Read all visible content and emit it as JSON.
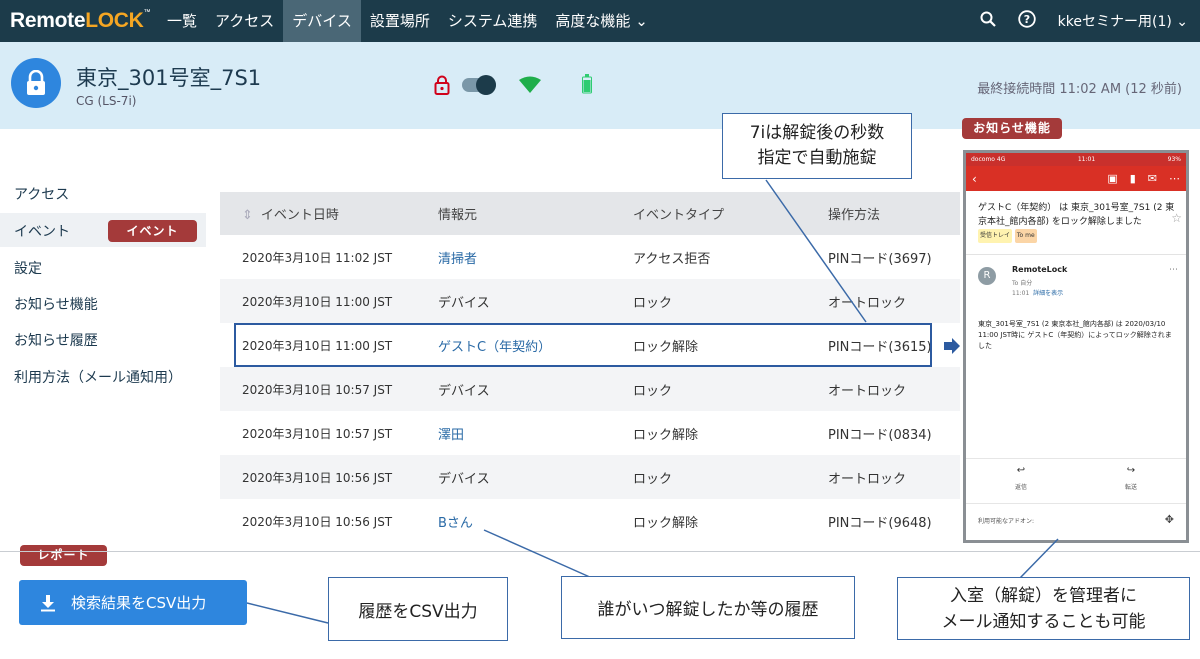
{
  "brand": {
    "logo_pre": "Remote",
    "logo_accent": "LOCK",
    "logo_tm": "™",
    "accent_color": "#f5a623"
  },
  "nav": {
    "items": [
      "一覧",
      "アクセス",
      "デバイス",
      "設置場所",
      "システム連携",
      "高度な機能 ⌄"
    ],
    "active": "デバイス",
    "account": "kkeセミナー用(1) ⌄"
  },
  "device": {
    "name": "東京_301号室_7S1",
    "model": "CG (LS-7i)",
    "last_connection": "最終接続時間 11:02 AM (12 秒前)"
  },
  "sidebar": {
    "items": [
      "アクセス",
      "イベント",
      "設定",
      "お知らせ機能",
      "お知らせ履歴",
      "利用方法（メール通知用）"
    ],
    "active": "イベント"
  },
  "tags": {
    "event": "イベント",
    "notice": "お知らせ機能",
    "report": "レポート"
  },
  "table": {
    "headers": [
      "イベント日時",
      "情報元",
      "イベントタイプ",
      "操作方法"
    ],
    "rows": [
      [
        "2020年3月10日 11:02 JST",
        "清掃者",
        "アクセス拒否",
        "PINコード(3697)"
      ],
      [
        "2020年3月10日 11:00 JST",
        "デバイス",
        "ロック",
        "オートロック"
      ],
      [
        "2020年3月10日 11:00 JST",
        "ゲストC（年契約）",
        "ロック解除",
        "PINコード(3615)"
      ],
      [
        "2020年3月10日 10:57 JST",
        "デバイス",
        "ロック",
        "オートロック"
      ],
      [
        "2020年3月10日 10:57 JST",
        "澤田",
        "ロック解除",
        "PINコード(0834)"
      ],
      [
        "2020年3月10日 10:56 JST",
        "デバイス",
        "ロック",
        "オートロック"
      ],
      [
        "2020年3月10日 10:56 JST",
        "Bさん",
        "ロック解除",
        "PINコード(9648)"
      ]
    ],
    "link_rows": [
      0,
      2,
      4,
      6
    ]
  },
  "csv_button": "検索結果をCSV出力",
  "callouts": {
    "autolock": [
      "7iは解錠後の秒数",
      "指定で自動施錠"
    ],
    "csv": "履歴をCSV出力",
    "history": "誰がいつ解錠したか等の履歴",
    "mail": [
      "入室（解錠）を管理者に",
      "メール通知することも可能"
    ]
  },
  "phone": {
    "status_left": "docomo 4G",
    "status_time": "11:01",
    "status_right": "93%",
    "subject": "ゲストC（年契約） は 東京_301号室_7S1 (2 東京本社_館内各部) をロック解除しました",
    "chip1": "受信トレイ",
    "chip2": "To me",
    "sender": "RemoteLock",
    "to": "To 自分",
    "meta_time": "11:01",
    "meta_link": "詳細を表示",
    "avatar": "R",
    "body": "東京_301号室_7S1 (2 東京本社_館内各部) は 2020/03/10 11:00 JST時に ゲストC（年契約）によってロック解除されました",
    "reply": "返信",
    "forward": "転送",
    "addon": "利用可能なアドオン:"
  }
}
